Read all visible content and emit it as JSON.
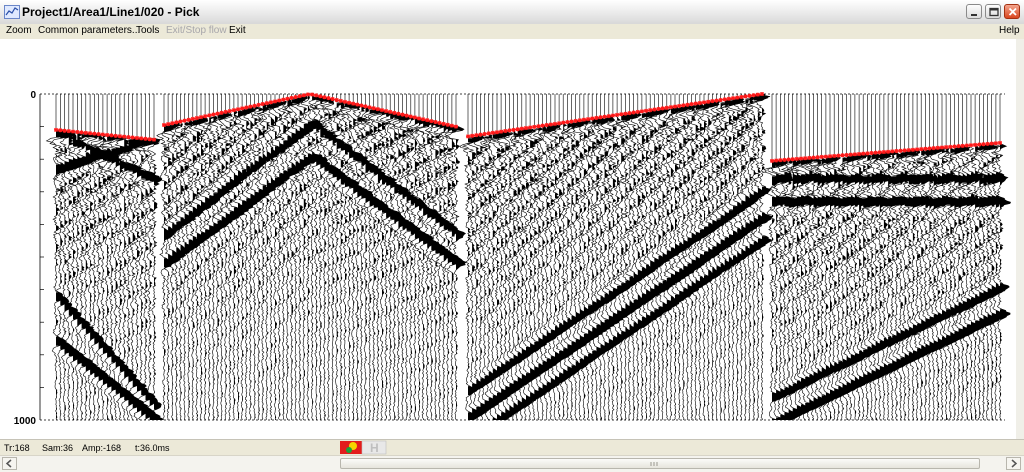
{
  "window": {
    "title": "Project1/Area1/Line1/020 - Pick"
  },
  "menu": {
    "zoom": "Zoom",
    "common_parameters": "Common parameters...",
    "tools": "Tools",
    "exit_stop_flow": "Exit/Stop flow",
    "exit": "Exit",
    "help": "Help"
  },
  "axis": {
    "top_label": "0",
    "bottom_label": "1000",
    "time_min_ms": 0,
    "time_max_ms": 1000
  },
  "status": {
    "trace": "Tr:168",
    "sample": "Sam:36",
    "amplitude": "Amp:-168",
    "time": "t:36.0ms"
  },
  "colors": {
    "pick_line": "#ff1a1a",
    "wiggle": "#000000",
    "background": "#ffffff"
  },
  "chart_data": {
    "type": "seismic-wiggle",
    "title": "",
    "xlabel": "",
    "ylabel": "",
    "ylim": [
      0,
      1000
    ],
    "panels": [
      {
        "name": "",
        "traces": 24,
        "first_break_ms": [
          110,
          140
        ],
        "events": [
          {
            "t0": 120,
            "slope": 6
          },
          {
            "t0": 230,
            "slope": -4
          },
          {
            "t0": 620,
            "slope": 14
          },
          {
            "t0": 760,
            "slope": 10
          }
        ]
      },
      {
        "name": "",
        "traces": 72,
        "first_break_ms": [
          95,
          0,
          100
        ],
        "events": [
          {
            "t0": 430,
            "vee": 340
          },
          {
            "t0": 520,
            "vee": 330
          }
        ]
      },
      {
        "name": "",
        "traces": 72,
        "first_break_ms": [
          130,
          0
        ],
        "events": [
          {
            "t0": 910,
            "slope": -8.5
          },
          {
            "t0": 990,
            "slope": -8.5
          },
          {
            "t0": 1060,
            "slope": -8.5
          }
        ]
      },
      {
        "name": "",
        "traces": 56,
        "first_break_ms": [
          205,
          150
        ],
        "events": [
          {
            "t0": 260,
            "slope": 0
          },
          {
            "t0": 330,
            "slope": 0
          },
          {
            "t0": 930,
            "slope": -6
          },
          {
            "t0": 1010,
            "slope": -6
          }
        ]
      }
    ]
  }
}
